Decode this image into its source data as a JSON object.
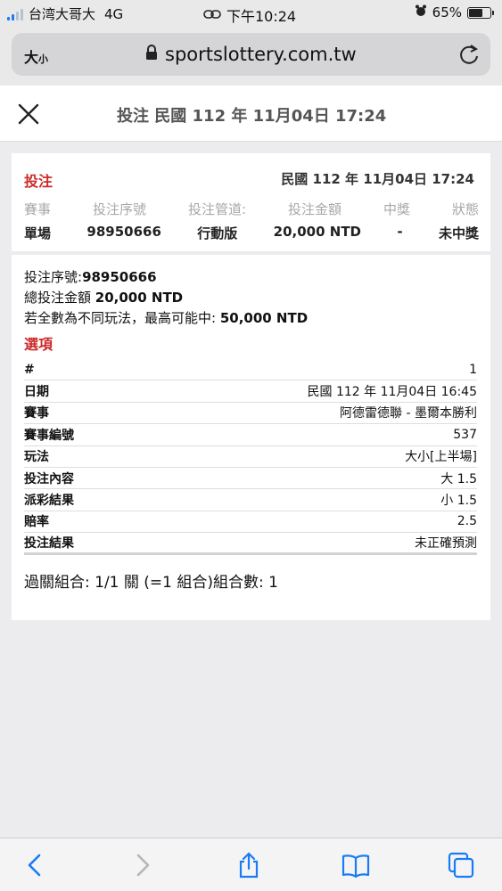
{
  "status_bar": {
    "carrier": "台湾大哥大",
    "network": "4G",
    "time": "下午10:24",
    "battery_percent": "65%",
    "battery_level": 0.65,
    "icons": [
      "signal-icon",
      "link-icon",
      "alarm-icon",
      "battery-icon"
    ]
  },
  "browser": {
    "text_size_big": "大",
    "text_size_small": "小",
    "url": "sportslottery.com.tw"
  },
  "titlebar": {
    "title": "投注 民國 112 年 11月04日 17:24"
  },
  "card": {
    "heading": "投注",
    "date": "民國 112 年 11月04日 17:24",
    "summary_headers": [
      "賽事",
      "投注序號",
      "投注管道:",
      "投注金額",
      "中獎",
      "狀態"
    ],
    "summary_values": [
      "單場",
      "98950666",
      "行動版",
      "20,000 NTD",
      "-",
      "未中獎"
    ],
    "serial_label": "投注序號:",
    "serial_value": "98950666",
    "total_label": "總投注金額 ",
    "total_value": "20,000 NTD",
    "max_label": "若全數為不同玩法，最高可能中: ",
    "max_value": "50,000 NTD",
    "options_title": "選項",
    "rows": [
      {
        "key": "#",
        "value": "1"
      },
      {
        "key": "日期",
        "value": "民國 112 年 11月04日 16:45"
      },
      {
        "key": "賽事",
        "value": "阿德雷德聯 - 墨爾本勝利"
      },
      {
        "key": "賽事編號",
        "value": "537"
      },
      {
        "key": "玩法",
        "value": "大小[上半場]"
      },
      {
        "key": "投注內容",
        "value": "大 1.5"
      },
      {
        "key": "派彩結果",
        "value": "小 1.5"
      },
      {
        "key": "賠率",
        "value": "2.5"
      },
      {
        "key": "投注結果",
        "value": "未正確預測"
      }
    ],
    "combo": "過關組合: 1/1 關 (=1 組合)組合數: 1"
  },
  "toolbar": {
    "icons": [
      "back-icon",
      "forward-icon",
      "share-icon",
      "bookmarks-icon",
      "tabs-icon"
    ]
  }
}
